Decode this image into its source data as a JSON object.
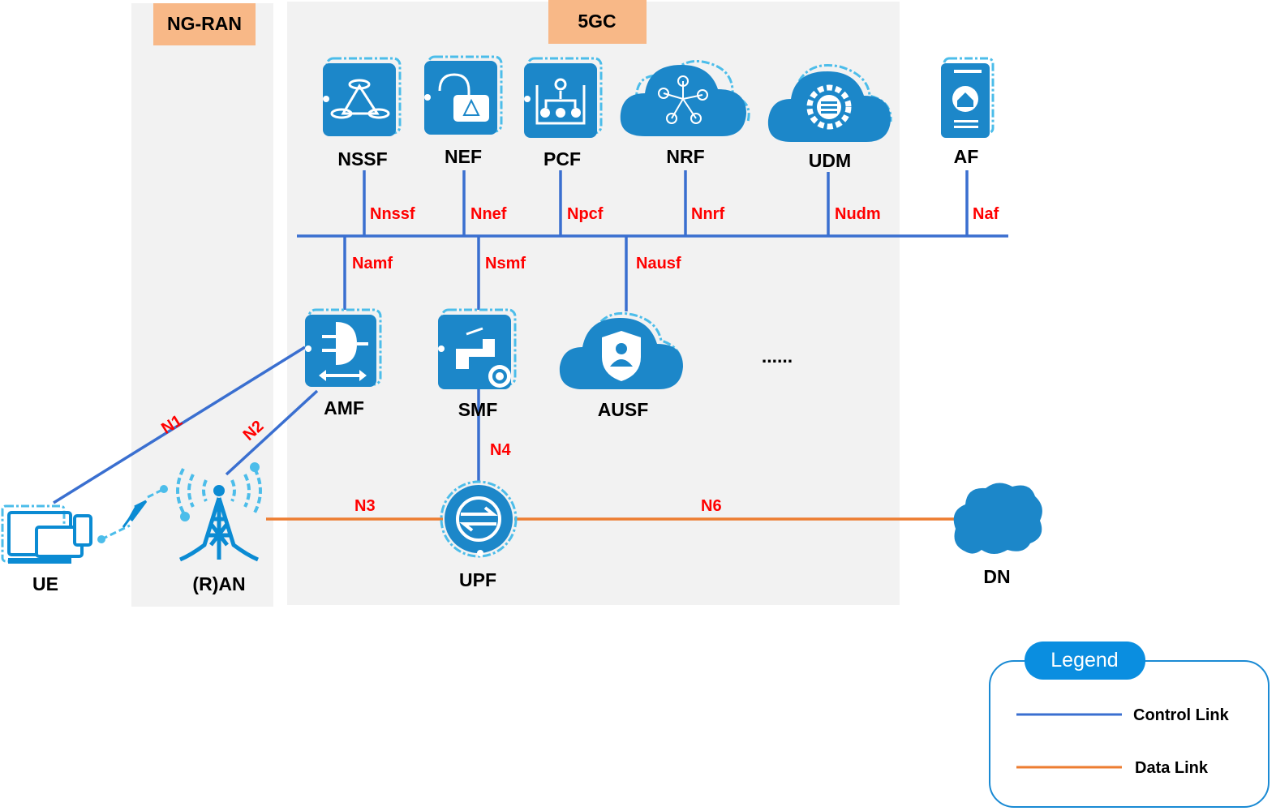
{
  "regions": {
    "ngran": "NG-RAN",
    "core": "5GC"
  },
  "functions": {
    "nssf": "NSSF",
    "nef": "NEF",
    "pcf": "PCF",
    "nrf": "NRF",
    "udm": "UDM",
    "af": "AF",
    "amf": "AMF",
    "smf": "SMF",
    "ausf": "AUSF",
    "more": "......",
    "upf": "UPF",
    "ue": "UE",
    "ran": "(R)AN",
    "dn": "DN"
  },
  "interfaces": {
    "nnssf": "Nnssf",
    "nnef": "Nnef",
    "npcf": "Npcf",
    "nnrf": "Nnrf",
    "nudm": "Nudm",
    "naf": "Naf",
    "namf": "Namf",
    "nsmf": "Nsmf",
    "nausf": "Nausf",
    "n1": "N1",
    "n2": "N2",
    "n3": "N3",
    "n4": "N4",
    "n6": "N6"
  },
  "legend": {
    "title": "Legend",
    "items": [
      {
        "label": "Control Link",
        "color": "#3a6fd0"
      },
      {
        "label": "Data Link",
        "color": "#ed7d31"
      }
    ]
  },
  "colors": {
    "control": "#3a6fd0",
    "data": "#ed7d31",
    "icon": "#1c87c9",
    "interface_label": "#ff0000",
    "region_label": "#f8b887"
  }
}
